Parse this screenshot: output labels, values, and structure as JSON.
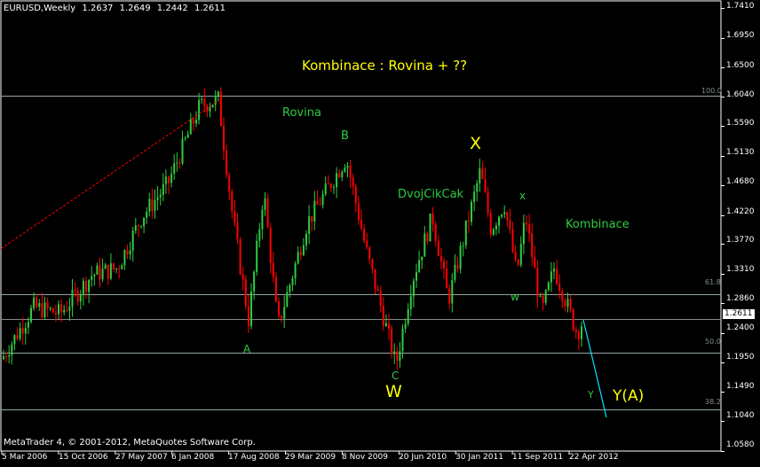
{
  "header": {
    "symbol": "EURUSD,Weekly",
    "open": "1.2637",
    "high": "1.2649",
    "low": "1.2442",
    "close": "1.2611"
  },
  "footer": {
    "copyright": "MetaTrader 4, © 2001-2012, MetaQuotes Software Corp."
  },
  "price_axis": {
    "ticks": [
      "1.7410",
      "1.6950",
      "1.6500",
      "1.6040",
      "1.5590",
      "1.5130",
      "1.4680",
      "1.4220",
      "1.3770",
      "1.3310",
      "1.2860",
      "1.2400",
      "1.1950",
      "1.1490",
      "1.1040",
      "1.0580"
    ],
    "current_price": "1.2611"
  },
  "time_axis": {
    "ticks": [
      "5 Mar 2006",
      "15 Oct 2006",
      "27 May 2007",
      "6 Jan 2008",
      "17 Aug 2008",
      "29 Mar 2009",
      "8 Nov 2009",
      "20 Jun 2010",
      "30 Jan 2011",
      "11 Sep 2011",
      "22 Apr 2012"
    ]
  },
  "fib_levels": [
    {
      "label": "100.0",
      "price": 1.606
    },
    {
      "label": "61.8",
      "price": 1.3
    },
    {
      "label": "50.0",
      "price": 1.21
    },
    {
      "label": "38.2",
      "price": 1.122
    }
  ],
  "annotations": {
    "title": "Kombinace : Rovina + ??",
    "rovina": "Rovina",
    "b": "B",
    "x_major": "X",
    "dvojcikcak": "DvojCikCak",
    "x_minor": "x",
    "kombinace": "Kombinace",
    "w_minor": "w",
    "a": "A",
    "c": "C",
    "w_major": "W",
    "y_minor": "Y",
    "ya": "Y(A)"
  },
  "colors": {
    "background": "#000000",
    "bull_candle": "#2ecc40",
    "bear_candle": "#ff0000",
    "grid_line": "#95a5a6",
    "text_green": "#2ecc40",
    "text_yellow": "#ffff00",
    "projection": "#00e5ff",
    "trendline": "#ff0000"
  },
  "chart_data": {
    "type": "candlestick",
    "title": "Kombinace : Rovina + ??",
    "instrument": "EURUSD",
    "timeframe": "Weekly",
    "ylim": [
      1.058,
      1.741
    ],
    "x_range": [
      "Mar 2006",
      "Jul 2012"
    ],
    "path": [
      {
        "date": "Mar 2006",
        "price": 1.2
      },
      {
        "date": "Jun 2006",
        "price": 1.28
      },
      {
        "date": "Oct 2006",
        "price": 1.27
      },
      {
        "date": "Mar 2007",
        "price": 1.33
      },
      {
        "date": "Jun 2007",
        "price": 1.34
      },
      {
        "date": "Sep 2007",
        "price": 1.42
      },
      {
        "date": "Dec 2007",
        "price": 1.47
      },
      {
        "date": "Apr 2008",
        "price": 1.59
      },
      {
        "date": "Jul 2008",
        "price": 1.6
      },
      {
        "date": "Sep 2008",
        "price": 1.42
      },
      {
        "date": "Oct 2008",
        "price": 1.26
      },
      {
        "date": "Dec 2008",
        "price": 1.46
      },
      {
        "date": "Feb 2009",
        "price": 1.25
      },
      {
        "date": "Jun 2009",
        "price": 1.41
      },
      {
        "date": "Nov 2009",
        "price": 1.51
      },
      {
        "date": "Feb 2010",
        "price": 1.37
      },
      {
        "date": "Jun 2010",
        "price": 1.19
      },
      {
        "date": "Aug 2010",
        "price": 1.32
      },
      {
        "date": "Nov 2010",
        "price": 1.42
      },
      {
        "date": "Jan 2011",
        "price": 1.29
      },
      {
        "date": "May 2011",
        "price": 1.49
      },
      {
        "date": "Jul 2011",
        "price": 1.4
      },
      {
        "date": "Aug 2011",
        "price": 1.44
      },
      {
        "date": "Oct 2011",
        "price": 1.33
      },
      {
        "date": "Oct 2011 ",
        "price": 1.42
      },
      {
        "date": "Jan 2012",
        "price": 1.27
      },
      {
        "date": "Feb 2012",
        "price": 1.34
      },
      {
        "date": "Jun 2012",
        "price": 1.24
      },
      {
        "date": "Jul 2012",
        "price": 1.26
      }
    ],
    "projection": {
      "from_price": 1.26,
      "to_price": 1.11
    },
    "trendline": {
      "from_price": 1.37,
      "to_price": 1.6
    }
  }
}
